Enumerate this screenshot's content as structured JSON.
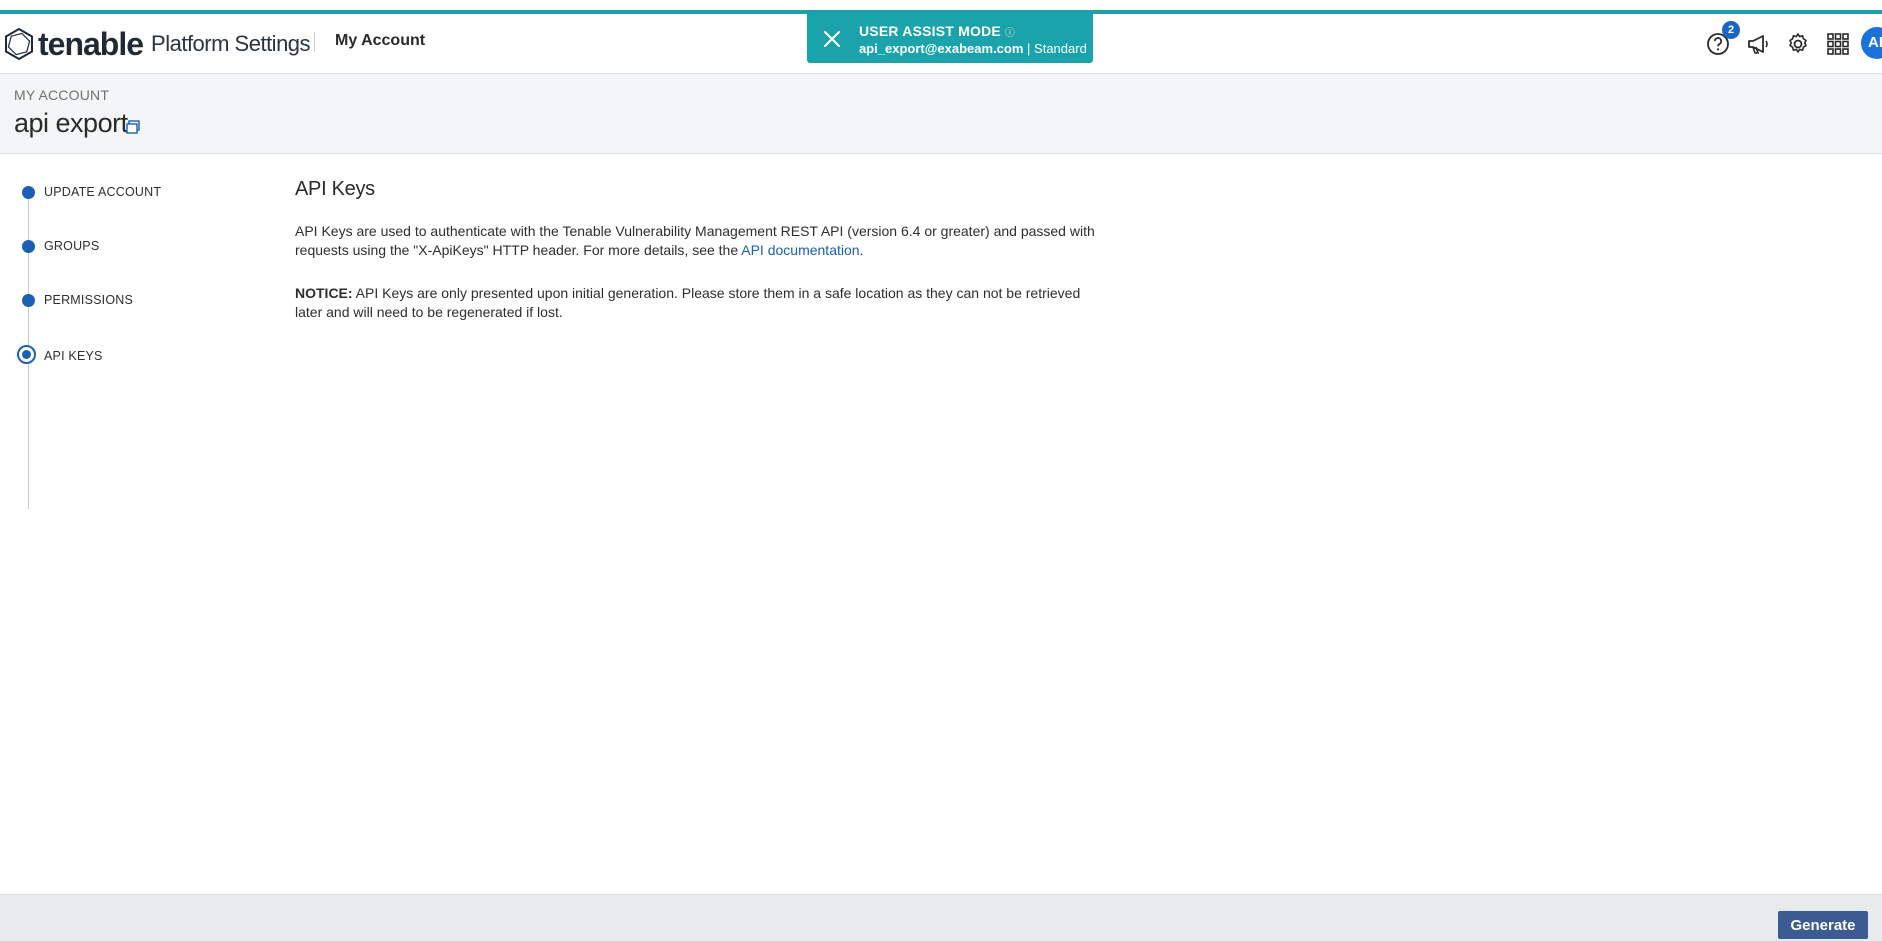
{
  "header": {
    "brand": "tenable",
    "product": "Platform Settings",
    "section": "My Account",
    "help_badge": "2",
    "avatar_initials": "AE",
    "icons": [
      "help-icon",
      "announcement-icon",
      "gear-icon",
      "apps-grid-icon"
    ]
  },
  "assist_banner": {
    "title": "USER ASSIST MODE",
    "info_glyph": "ⓘ",
    "user": "api_export@exabeam.com",
    "separator": " | ",
    "role": "Standard"
  },
  "subheader": {
    "breadcrumb": "MY ACCOUNT",
    "title": "api export"
  },
  "stepper": {
    "steps": [
      {
        "label": "UPDATE ACCOUNT",
        "active": false
      },
      {
        "label": "GROUPS",
        "active": false
      },
      {
        "label": "PERMISSIONS",
        "active": false
      },
      {
        "label": "API KEYS",
        "active": true
      }
    ]
  },
  "content": {
    "heading": "API Keys",
    "para1_text": "API Keys are used to authenticate with the Tenable Vulnerability Management REST API (version 6.4 or greater) and passed with requests using the \"X-ApiKeys\" HTTP header. For more details, see the ",
    "para1_link": "API documentation",
    "para1_end": ".",
    "notice_label": "NOTICE:",
    "notice_text": " API Keys are only presented upon initial generation. Please store them in a safe location as they can not be retrieved later and will need to be regenerated if lost."
  },
  "footer": {
    "generate_label": "Generate"
  },
  "colors": {
    "accent_teal": "#1aa3aa",
    "primary_blue": "#1a5fb4",
    "button_blue": "#3b5b92"
  }
}
